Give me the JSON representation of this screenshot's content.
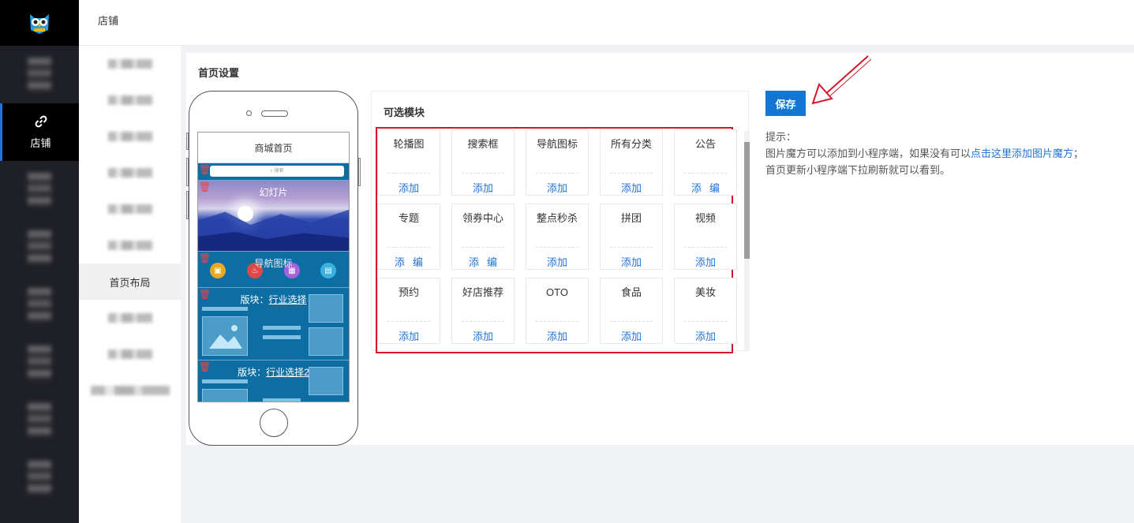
{
  "header": {
    "title": "店铺"
  },
  "rail": {
    "active_label": "店铺",
    "active_icon": "link-icon"
  },
  "subnav": {
    "active_label": "首页布局"
  },
  "panel": {
    "title": "首页设置"
  },
  "phone": {
    "screen_title": "商城首页",
    "search_placeholder": "搜索",
    "slide_label": "幻灯片",
    "nav_label": "导航图标",
    "block1_prefix": "版块：",
    "block1_link": "行业选择",
    "block2_prefix": "版块：",
    "block2_link": "行业选择2"
  },
  "modules": {
    "title": "可选模块",
    "items": [
      {
        "name": "轮播图",
        "actions": [
          "添加"
        ]
      },
      {
        "name": "搜索框",
        "actions": [
          "添加"
        ]
      },
      {
        "name": "导航图标",
        "actions": [
          "添加"
        ]
      },
      {
        "name": "所有分类",
        "actions": [
          "添加"
        ]
      },
      {
        "name": "公告",
        "actions": [
          "添",
          "编"
        ]
      },
      {
        "name": "专题",
        "actions": [
          "添",
          "编"
        ]
      },
      {
        "name": "领券中心",
        "actions": [
          "添",
          "编"
        ]
      },
      {
        "name": "整点秒杀",
        "actions": [
          "添加"
        ]
      },
      {
        "name": "拼团",
        "actions": [
          "添加"
        ]
      },
      {
        "name": "视频",
        "actions": [
          "添加"
        ]
      },
      {
        "name": "预约",
        "actions": [
          "添加"
        ]
      },
      {
        "name": "好店推荐",
        "actions": [
          "添加"
        ]
      },
      {
        "name": "OTO",
        "actions": [
          "添加"
        ]
      },
      {
        "name": "食品",
        "actions": [
          "添加"
        ]
      },
      {
        "name": "美妆",
        "actions": [
          "添加"
        ]
      }
    ]
  },
  "actions": {
    "save_label": "保存"
  },
  "tips": {
    "title": "提示：",
    "line1_before": "图片魔方可以添加到小程序端，如果没有可以",
    "line1_link": "点击这里添加图片魔方",
    "line1_after": "；",
    "line2": "首页更新小程序端下拉刷新就可以看到。"
  },
  "colors": {
    "accent": "#1377d2",
    "highlight_frame": "#d4182a",
    "rail_bg": "#1f1f27"
  }
}
